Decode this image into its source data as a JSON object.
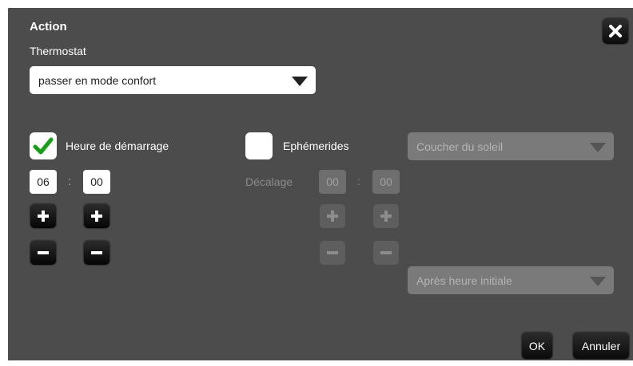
{
  "dialog": {
    "title": "Action",
    "subtitle": "Thermostat",
    "action_select": {
      "value": "passer en mode confort",
      "icon": "chevron-down-icon"
    },
    "close": {
      "icon": "close-icon"
    }
  },
  "start_time": {
    "label": "Heure de démarrage",
    "checked": true,
    "hours": "06",
    "separator": ":",
    "minutes": "00"
  },
  "ephemerides": {
    "label": "Ephémerides",
    "checked": false,
    "offset_label": "Décalage",
    "offset_hours": "00",
    "separator": ":",
    "offset_minutes": "00",
    "event_select": {
      "value": "Coucher du soleil"
    },
    "mode_select": {
      "value": "Après heure initiale"
    }
  },
  "footer": {
    "ok_label": "OK",
    "cancel_label": "Annuler"
  },
  "colors": {
    "dialog_background": "#4c4c4c",
    "check_green": "#1a9e1a",
    "button_dark": "#0c0c0c"
  }
}
